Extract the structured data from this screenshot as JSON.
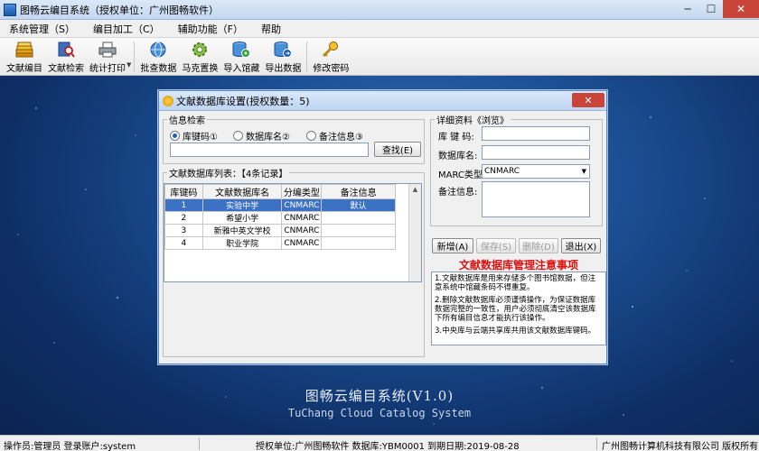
{
  "window": {
    "title": "图畅云编目系统（授权单位：广州图畅软件）",
    "minimize": "─",
    "maximize": "☐",
    "close": "✕"
  },
  "menu": [
    "系统管理（S）",
    "编目加工（C）",
    "辅助功能（F）",
    "帮助"
  ],
  "toolbar": [
    {
      "label": "文献编目",
      "icon": "books-icon"
    },
    {
      "label": "文献检索",
      "icon": "search-book-icon"
    },
    {
      "label": "统计打印",
      "icon": "printer-icon"
    },
    {
      "label": "批查数据",
      "icon": "globe-icon"
    },
    {
      "label": "马克置换",
      "icon": "gear-icon"
    },
    {
      "label": "导入馆藏",
      "icon": "database-import-icon"
    },
    {
      "label": "导出数据",
      "icon": "database-export-icon"
    },
    {
      "label": "修改密码",
      "icon": "key-icon"
    }
  ],
  "dialog": {
    "title": "文献数据库设置(授权数量：5)",
    "close": "✕",
    "search_group": {
      "legend": "信息检索",
      "options": [
        "库键码①",
        "数据库名②",
        "备注信息③"
      ],
      "selected": 0,
      "query": "",
      "search_button": "查找(E)"
    },
    "list_group": {
      "legend": "文献数据库列表：【4条记录】",
      "columns": [
        "库键码",
        "文献数据库名",
        "分编类型",
        "备注信息"
      ],
      "rows": [
        {
          "code": "1",
          "name": "实验中学",
          "type": "CNMARC",
          "note": "默认"
        },
        {
          "code": "2",
          "name": "希望小学",
          "type": "CNMARC",
          "note": ""
        },
        {
          "code": "3",
          "name": "新雅中英文学校",
          "type": "CNMARC",
          "note": ""
        },
        {
          "code": "4",
          "name": "职业学院",
          "type": "CNMARC",
          "note": ""
        }
      ],
      "selected_row": 0
    },
    "detail_group": {
      "legend": "详细资料《浏览》",
      "key_label": "库 键 码:",
      "key_value": "",
      "name_label": "数据库名:",
      "name_value": "",
      "marc_label": "MARC类型:",
      "marc_value": "CNMARC",
      "note_label": "备注信息:",
      "note_value": ""
    },
    "buttons": {
      "add": "新增(A)",
      "save": "保存(S)",
      "delete": "删除(D)",
      "exit": "退出(X)"
    },
    "notes_title": "文献数据库管理注意事项",
    "notes": [
      "1.文献数据库是用来存储多个图书馆数据，但注意系统中馆藏条码不得重复。",
      "2.删除文献数据库必须谨慎操作，为保证数据库数据完整的一致性，用户必须彻底清空该数据库下所有编目信息才能执行该操作。",
      "3.中央库与云端共享库共用该文献数据库键码。"
    ]
  },
  "banner": {
    "cn": "图畅云编目系统(V1.0)",
    "en": "TuChang Cloud Catalog System"
  },
  "status": {
    "operator": "操作员:管理员 登录账户:system",
    "center": "授权单位:广州图畅软件 数据库:YBM0001 到期日期:2019-08-28",
    "right": "广州图畅计算机科技有限公司 版权所有"
  },
  "colors": {
    "selected_row": "#3b72c4",
    "notes_title": "#e01010",
    "close_button": "#c9453a"
  }
}
